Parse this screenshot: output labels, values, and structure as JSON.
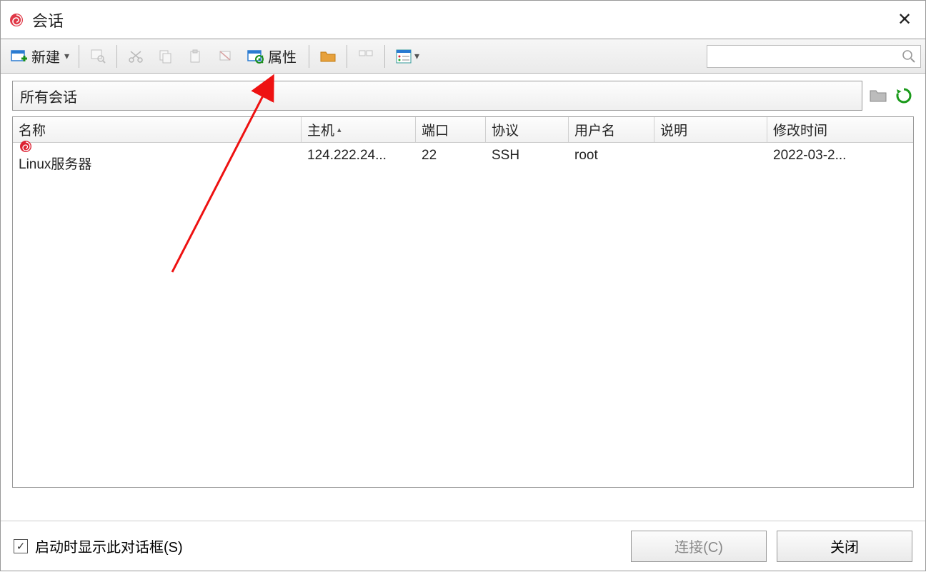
{
  "window": {
    "title": "会话"
  },
  "toolbar": {
    "new_label": "新建",
    "properties_label": "属性"
  },
  "breadcrumb": {
    "path": "所有会话"
  },
  "columns": {
    "name": "名称",
    "host": "主机",
    "port": "端口",
    "protocol": "协议",
    "user": "用户名",
    "desc": "说明",
    "modified": "修改时间",
    "sort_indicator": "▴"
  },
  "rows": [
    {
      "name": "Linux服务器",
      "host": "124.222.24...",
      "port": "22",
      "protocol": "SSH",
      "user": "root",
      "desc": "",
      "modified": "2022-03-2..."
    }
  ],
  "footer": {
    "checkbox_label": "启动时显示此对话框(S)",
    "checkbox_checked": true,
    "connect_label": "连接(C)",
    "close_label": "关闭"
  }
}
